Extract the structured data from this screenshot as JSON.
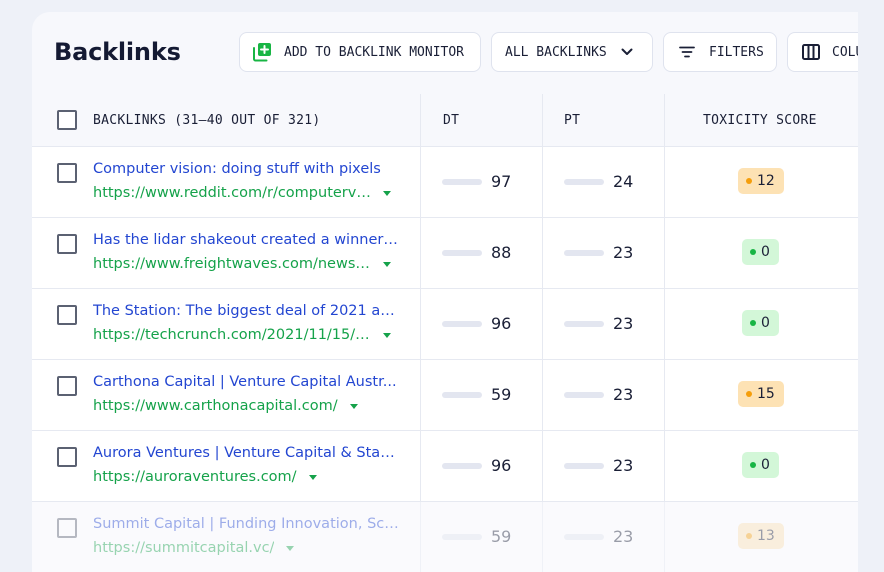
{
  "page": {
    "title": "Backlinks"
  },
  "toolbar": {
    "add_monitor_label": "ADD TO BACKLINK MONITOR",
    "filter_select_label": "ALL BACKLINKS",
    "filters_label": "FILTERS",
    "columns_label": "COLUMNS"
  },
  "colors": {
    "link_title": "#2346d1",
    "link_url": "#15a24a",
    "dt_bar": "#17234f",
    "pt_bar": "#8a24e8",
    "toxicity_medium": "#fde2b4",
    "toxicity_low": "#d3f7d8",
    "add_icon": "#18b544"
  },
  "table": {
    "headers": {
      "backlinks": "BACKLINKS (31–40 OUT OF 321)",
      "dt": "DT",
      "pt": "PT",
      "toxicity": "TOXICITY SCORE"
    },
    "rows": [
      {
        "title": "Computer vision: doing stuff with pixels",
        "url": "https://www.reddit.com/r/computervi...",
        "dt": 97,
        "pt": 24,
        "toxicity": 12,
        "toxicity_level": "orange"
      },
      {
        "title": "Has the lidar shakeout created a winner?...",
        "url": "https://www.freightwaves.com/news/...",
        "dt": 88,
        "pt": 23,
        "toxicity": 0,
        "toxicity_level": "green"
      },
      {
        "title": "The Station: The biggest deal of 2021 an...",
        "url": "https://techcrunch.com/2021/11/15/t...",
        "dt": 96,
        "pt": 23,
        "toxicity": 0,
        "toxicity_level": "green"
      },
      {
        "title": "Carthona Capital | Venture Capital Austr...",
        "url": "https://www.carthonacapital.com/",
        "dt": 59,
        "pt": 23,
        "toxicity": 15,
        "toxicity_level": "orange"
      },
      {
        "title": "Aurora Ventures | Venture Capital & Start...",
        "url": "https://auroraventures.com/",
        "dt": 96,
        "pt": 23,
        "toxicity": 0,
        "toxicity_level": "green"
      },
      {
        "title": "Summit Capital | Funding Innovation, Sca...",
        "url": "https://summitcapital.vc/",
        "dt": 59,
        "pt": 23,
        "toxicity": 13,
        "toxicity_level": "orange"
      }
    ]
  }
}
